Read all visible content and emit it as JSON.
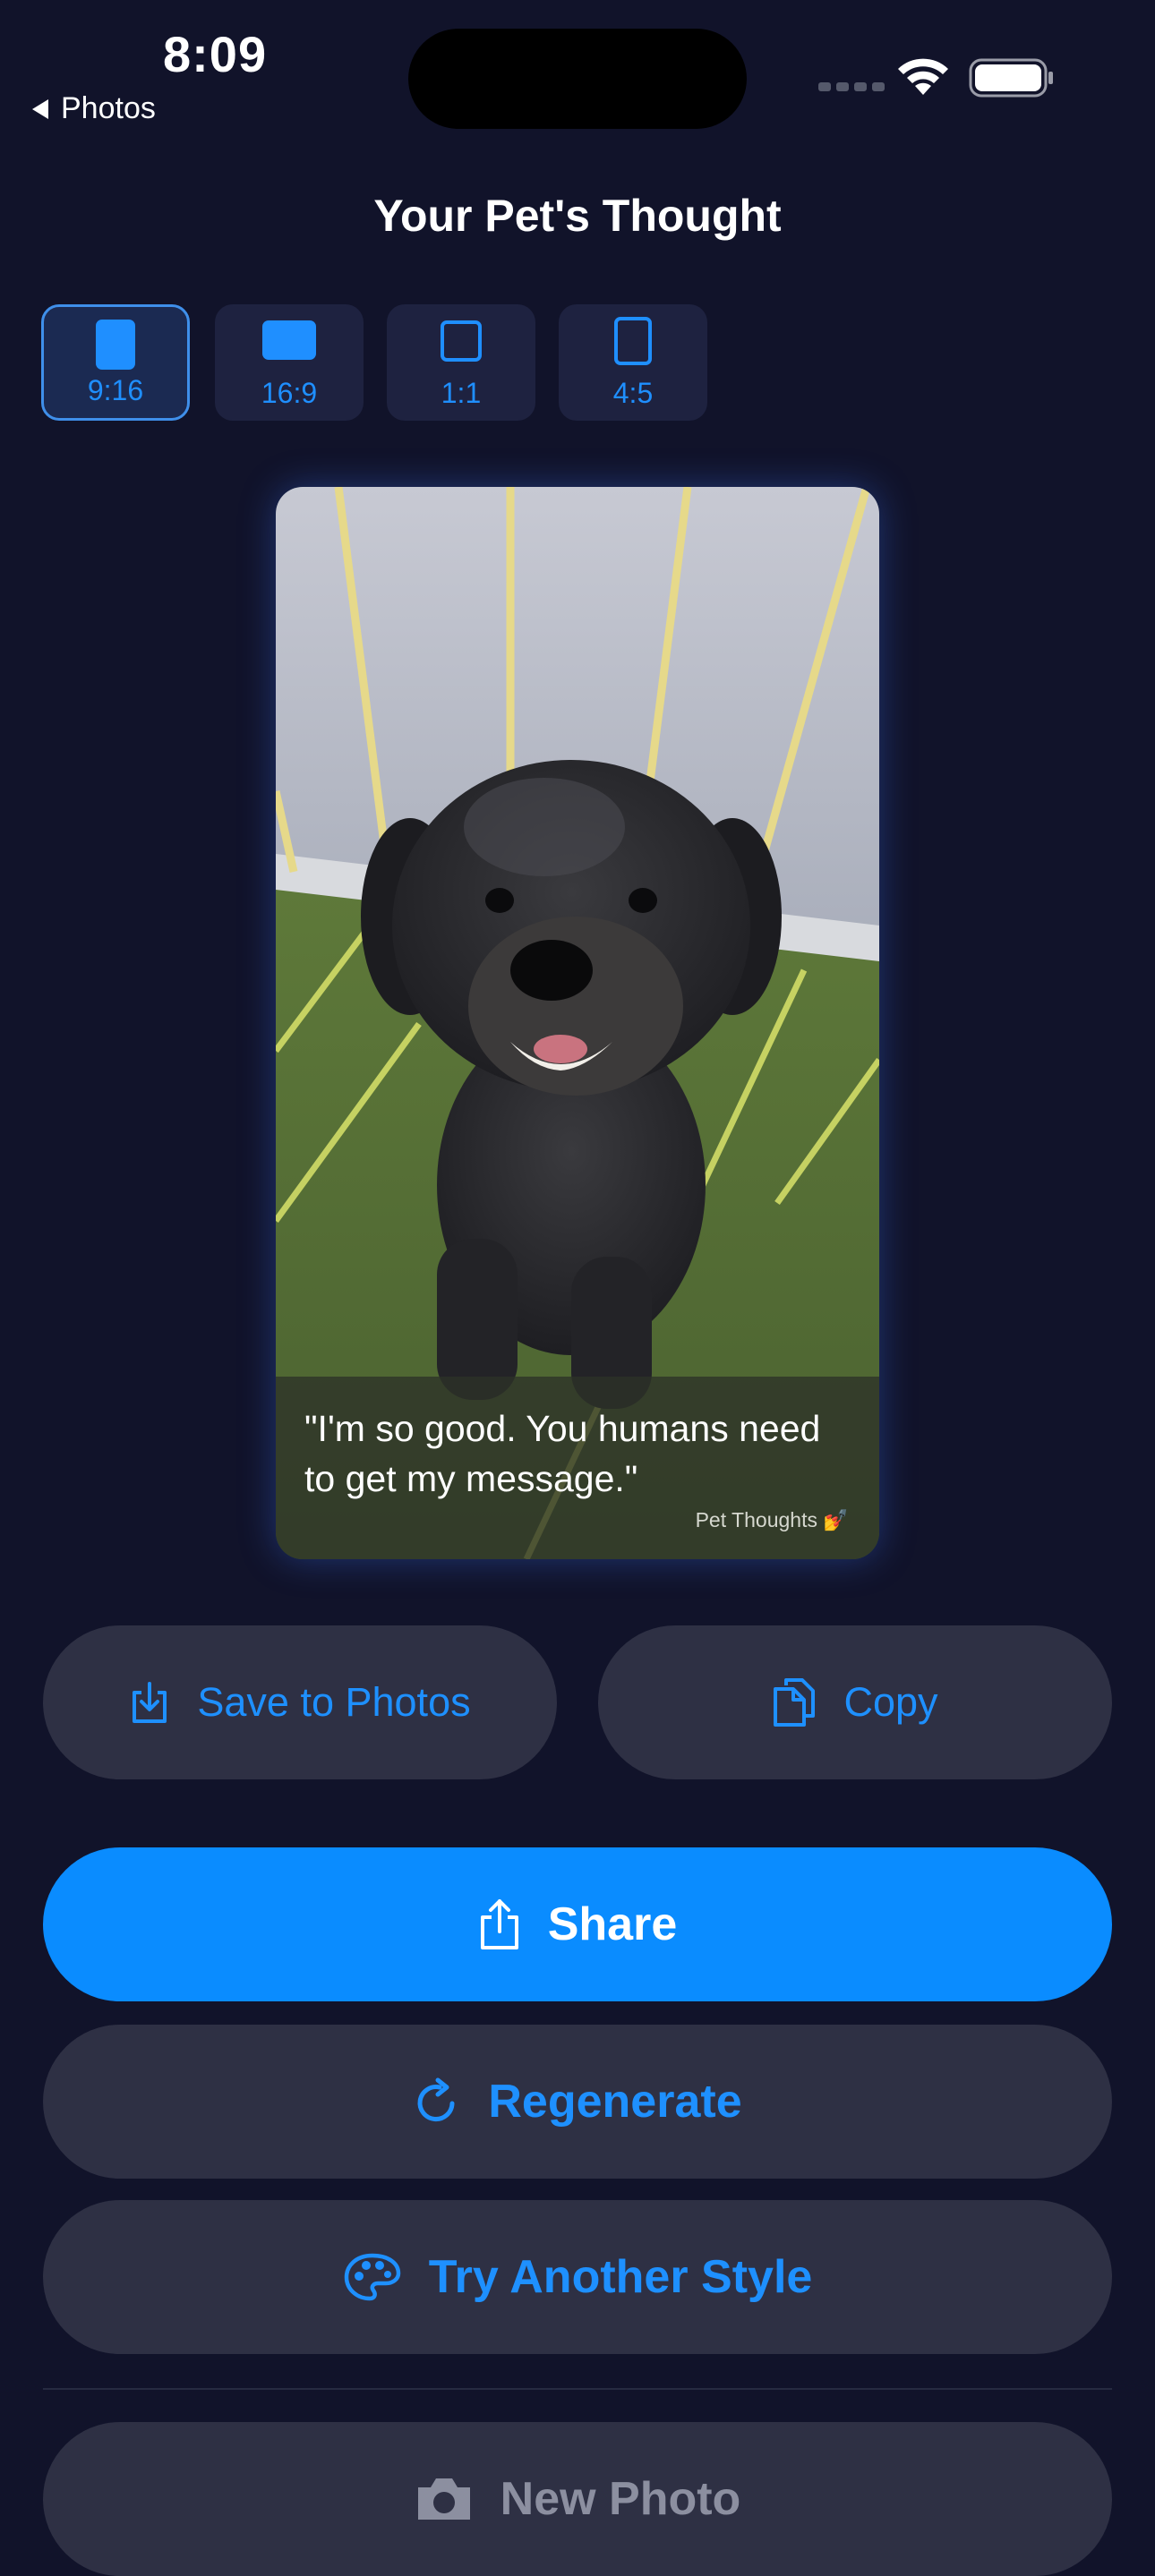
{
  "status_bar": {
    "time": "8:09",
    "back_label": "Photos"
  },
  "header": {
    "title": "Your Pet's Thought"
  },
  "aspect_ratios": [
    {
      "label": "9:16",
      "selected": true,
      "icon": "portrait-filled-icon"
    },
    {
      "label": "16:9",
      "selected": false,
      "icon": "landscape-filled-icon"
    },
    {
      "label": "1:1",
      "selected": false,
      "icon": "square-outline-icon"
    },
    {
      "label": "4:5",
      "selected": false,
      "icon": "portrait-outline-icon"
    }
  ],
  "preview": {
    "caption": "\"I'm so good. You humans need to get my message.\"",
    "brand": "Pet Thoughts",
    "brand_emoji": "💅",
    "image_subject": "dog-photo"
  },
  "actions": {
    "save_label": "Save to Photos",
    "copy_label": "Copy",
    "share_label": "Share",
    "regenerate_label": "Regenerate",
    "style_label": "Try Another Style",
    "new_photo_label": "New Photo"
  },
  "colors": {
    "background": "#11132a",
    "accent": "#1e90ff",
    "primary_button": "#0a8cff",
    "secondary_button": "#2e3044"
  }
}
